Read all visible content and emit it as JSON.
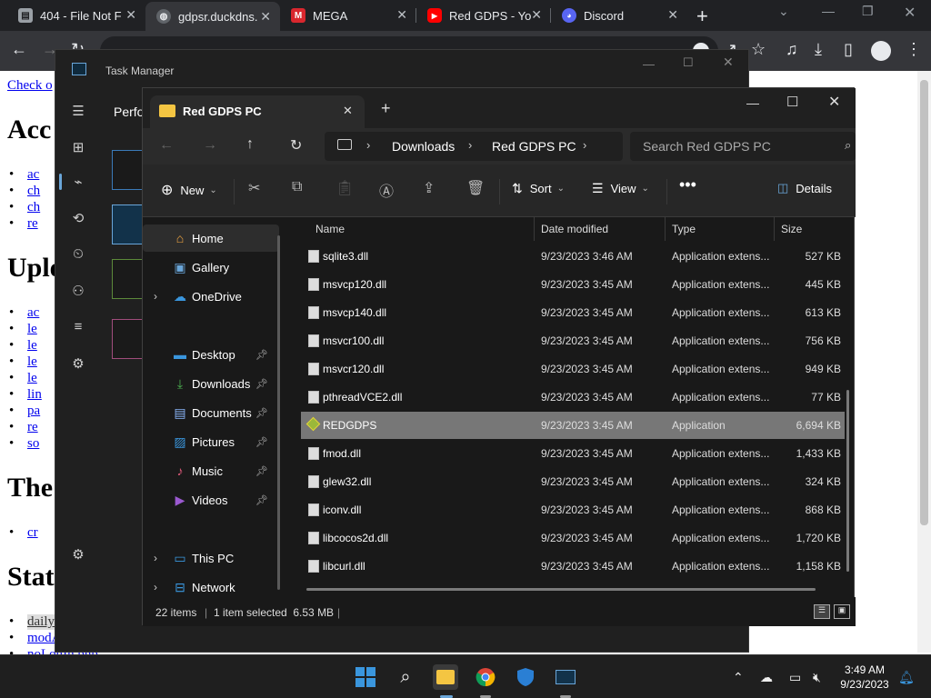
{
  "chrome": {
    "tabs": [
      {
        "title": "404 - File Not F",
        "icon": "page-icon",
        "color": "#9aa0a6"
      },
      {
        "title": "gdpsr.duckdns.",
        "icon": "globe-icon",
        "color": "#8ab4f8"
      },
      {
        "title": "MEGA",
        "icon": "mega-icon",
        "color": "#d9272e"
      },
      {
        "title": "Red GDPS - Yo",
        "icon": "youtube-icon",
        "color": "#ff0000"
      },
      {
        "title": "Discord",
        "icon": "discord-icon",
        "color": "#5865f2"
      }
    ],
    "omnibox_text": ""
  },
  "page": {
    "link_top": "Check o",
    "h1": "Acc",
    "h2": "Uplo",
    "h3": "The",
    "h4": "Stats relate",
    "list1": [
      "ac",
      "ch",
      "ch",
      "re"
    ],
    "list2": [
      "ac",
      "le",
      "le",
      "le",
      "le",
      "lin",
      "pa",
      "re",
      "so"
    ],
    "list3": [
      "cr"
    ],
    "list4": [
      "dailyTable.php",
      "modActions.php",
      "noLogIn.php"
    ]
  },
  "taskmgr": {
    "title": "Task Manager",
    "partial_heading": "Perfo"
  },
  "explorer": {
    "tab_title": "Red GDPS PC",
    "breadcrumb": [
      "Downloads",
      "Red GDPS PC"
    ],
    "search_placeholder": "Search Red GDPS PC",
    "cmd": {
      "new": "New",
      "sort": "Sort",
      "view": "View",
      "details": "Details"
    },
    "nav": {
      "home": "Home",
      "gallery": "Gallery",
      "onedrive": "OneDrive",
      "desktop": "Desktop",
      "downloads": "Downloads",
      "documents": "Documents",
      "pictures": "Pictures",
      "music": "Music",
      "videos": "Videos",
      "thispc": "This PC",
      "network": "Network"
    },
    "columns": {
      "name": "Name",
      "date": "Date modified",
      "type": "Type",
      "size": "Size"
    },
    "files": [
      {
        "name": "sqlite3.dll",
        "date": "9/23/2023 3:46 AM",
        "type": "Application extens...",
        "size": "527 KB"
      },
      {
        "name": "msvcp120.dll",
        "date": "9/23/2023 3:45 AM",
        "type": "Application extens...",
        "size": "445 KB"
      },
      {
        "name": "msvcp140.dll",
        "date": "9/23/2023 3:45 AM",
        "type": "Application extens...",
        "size": "613 KB"
      },
      {
        "name": "msvcr100.dll",
        "date": "9/23/2023 3:45 AM",
        "type": "Application extens...",
        "size": "756 KB"
      },
      {
        "name": "msvcr120.dll",
        "date": "9/23/2023 3:45 AM",
        "type": "Application extens...",
        "size": "949 KB"
      },
      {
        "name": "pthreadVCE2.dll",
        "date": "9/23/2023 3:45 AM",
        "type": "Application extens...",
        "size": "77 KB"
      },
      {
        "name": "REDGDPS",
        "date": "9/23/2023 3:45 AM",
        "type": "Application",
        "size": "6,694 KB"
      },
      {
        "name": "fmod.dll",
        "date": "9/23/2023 3:45 AM",
        "type": "Application extens...",
        "size": "1,433 KB"
      },
      {
        "name": "glew32.dll",
        "date": "9/23/2023 3:45 AM",
        "type": "Application extens...",
        "size": "324 KB"
      },
      {
        "name": "iconv.dll",
        "date": "9/23/2023 3:45 AM",
        "type": "Application extens...",
        "size": "868 KB"
      },
      {
        "name": "libcocos2d.dll",
        "date": "9/23/2023 3:45 AM",
        "type": "Application extens...",
        "size": "1,720 KB"
      },
      {
        "name": "libcurl.dll",
        "date": "9/23/2023 3:45 AM",
        "type": "Application extens...",
        "size": "1,158 KB"
      }
    ],
    "status": {
      "count": "22 items",
      "selected": "1 item selected  6.53 MB"
    }
  },
  "taskbar": {
    "time": "3:49 AM",
    "date": "9/23/2023"
  }
}
